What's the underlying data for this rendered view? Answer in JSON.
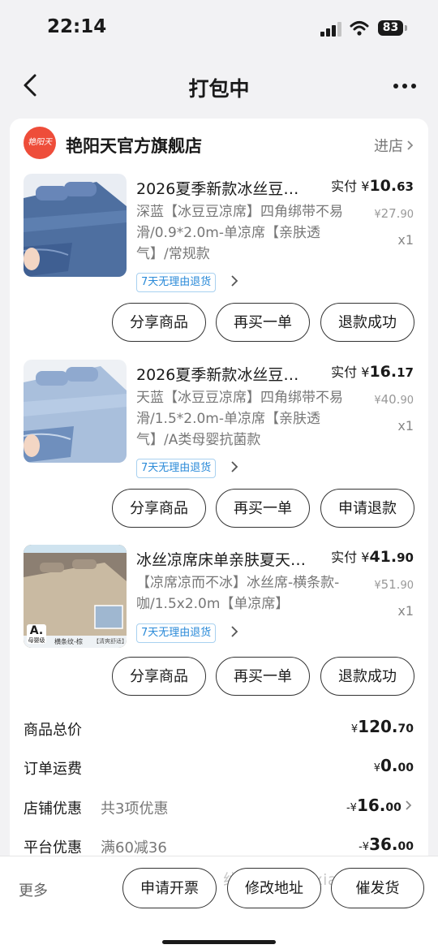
{
  "status": {
    "time": "22:14",
    "battery": "83"
  },
  "nav": {
    "title": "打包中"
  },
  "shop": {
    "logo_text": "艳阳天",
    "name": "艳阳天官方旗舰店",
    "enter": "进店"
  },
  "items": [
    {
      "title": "2026夏季新款冰丝豆…",
      "paid_label": "实付",
      "paid_currency": "¥",
      "paid_int": "10.",
      "paid_dec": "63",
      "orig_currency": "¥",
      "orig_int": "27.",
      "orig_dec": "90",
      "qty": "x1",
      "spec": "深蓝【冰豆豆凉席】四角绑带不易滑/0.9*2.0m-单凉席【亲肤透气】/常规款",
      "tag": "7天无理由退货",
      "buttons": [
        "分享商品",
        "再买一单",
        "退款成功"
      ]
    },
    {
      "title": "2026夏季新款冰丝豆…",
      "paid_label": "实付",
      "paid_currency": "¥",
      "paid_int": "16.",
      "paid_dec": "17",
      "orig_currency": "¥",
      "orig_int": "40.",
      "orig_dec": "90",
      "qty": "x1",
      "spec": "天蓝【冰豆豆凉席】四角绑带不易滑/1.5*2.0m-单凉席【亲肤透气】/A类母婴抗菌款",
      "tag": "7天无理由退货",
      "buttons": [
        "分享商品",
        "再买一单",
        "申请退款"
      ]
    },
    {
      "title": "冰丝凉席床单亲肤夏天…",
      "paid_label": "实付",
      "paid_currency": "¥",
      "paid_int": "41.",
      "paid_dec": "90",
      "orig_currency": "¥",
      "orig_int": "51.",
      "orig_dec": "90",
      "qty": "x1",
      "spec": "【凉席凉而不冰】冰丝席-横条款-咖/1.5x2.0m【单凉席】",
      "tag": "7天无理由退货",
      "thumb_badge": "A.",
      "thumb_badge_sub": "母婴级",
      "thumb_caption": "横条纹-棕",
      "thumb_caption2": "【清爽舒适】",
      "buttons": [
        "分享商品",
        "再买一单",
        "退款成功"
      ]
    }
  ],
  "summary": [
    {
      "label": "商品总价",
      "sub": "",
      "prefix": "¥",
      "int": "120.",
      "dec": "70"
    },
    {
      "label": "订单运费",
      "sub": "",
      "prefix": "¥",
      "int": "0.",
      "dec": "00"
    },
    {
      "label": "店铺优惠",
      "sub": "共3项优惠",
      "prefix": "-¥",
      "int": "16.",
      "dec": "00"
    },
    {
      "label": "平台优惠",
      "sub": "满60减36",
      "prefix": "-¥",
      "int": "36.",
      "dec": "00"
    }
  ],
  "bottom": {
    "more": "更多",
    "watermark": "线报酷-new.xianbao.fun",
    "buttons": [
      "申请开票",
      "修改地址",
      "催发货"
    ]
  }
}
